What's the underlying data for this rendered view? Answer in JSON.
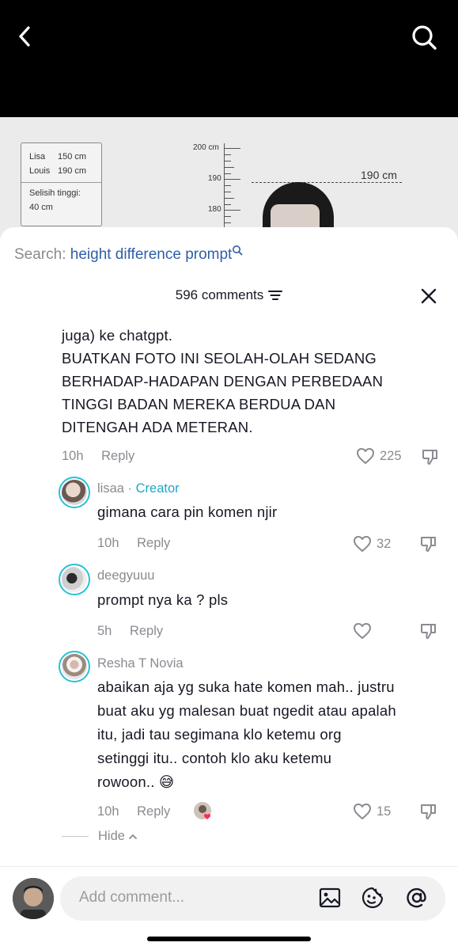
{
  "video": {
    "card_lines": [
      {
        "name": "Lisa",
        "value": "150 cm"
      },
      {
        "name": "Louis",
        "value": "190 cm"
      }
    ],
    "card_diff_label": "Selisih tinggi:",
    "card_diff_value": "40 cm",
    "ruler_labels": [
      "200 cm",
      "190",
      "180"
    ],
    "height_marker": "190 cm"
  },
  "search": {
    "prefix": "Search:",
    "keyword": "height difference prompt"
  },
  "comments_header": {
    "count_label": "596 comments"
  },
  "top_comment": {
    "text_lines": [
      "juga) ke chatgpt.",
      "BUATKAN FOTO INI SEOLAH-OLAH SEDANG",
      "BERHADAP-HADAPAN DENGAN PERBEDAAN",
      "TINGGI BADAN MEREKA BERDUA DAN",
      "DITENGAH ADA METERAN."
    ],
    "time": "10h",
    "reply_label": "Reply",
    "likes": "225"
  },
  "replies": [
    {
      "user": "lisaa",
      "separator": " · ",
      "badge": "Creator",
      "text": "gimana cara pin komen njir",
      "time": "10h",
      "reply_label": "Reply",
      "likes": "32"
    },
    {
      "user": "deegyuuu",
      "text": "prompt nya ka ? pls",
      "time": "5h",
      "reply_label": "Reply",
      "likes": ""
    },
    {
      "user": "Resha T Novia",
      "text_lines": [
        "abaikan aja yg suka hate komen mah.. justru",
        "buat aku yg malesan buat ngedit atau apalah",
        "itu, jadi tau segimana klo ketemu org",
        "setinggi itu.. contoh klo aku ketemu",
        "rowoon.. 😅"
      ],
      "time": "10h",
      "reply_label": "Reply",
      "likes": "15"
    }
  ],
  "hide_label": "Hide",
  "composer": {
    "placeholder": "Add comment..."
  }
}
